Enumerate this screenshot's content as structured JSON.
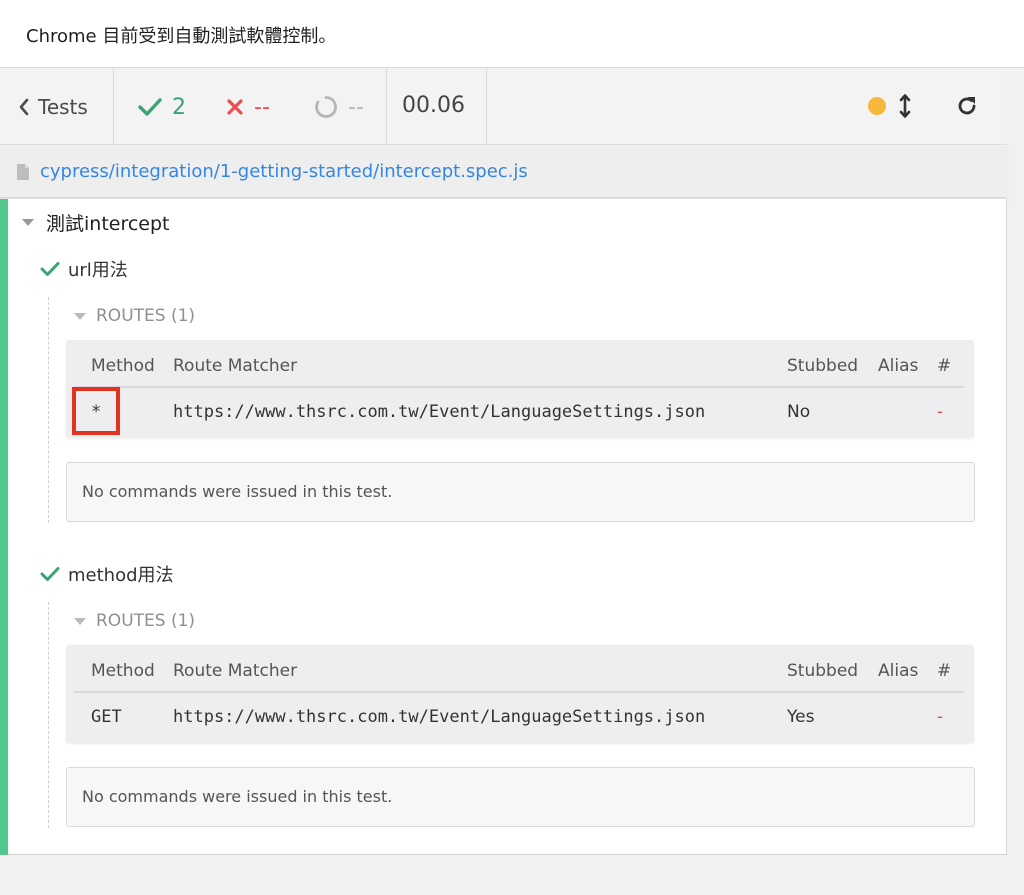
{
  "browser": {
    "automation_notice": "Chrome 目前受到自動測試軟體控制。"
  },
  "header": {
    "tests_label": "Tests",
    "passed_count": "2",
    "failed_count": "--",
    "pending_count": "--",
    "duration": "00.06",
    "icons": [
      "chevron-left-icon",
      "check-icon",
      "x-icon",
      "circle-notch-icon",
      "status-dot-icon",
      "arrows-v-icon",
      "redo-icon"
    ],
    "colors": {
      "passed": "#3aa573",
      "failed": "#e94f4f",
      "pending": "#b6b6b6",
      "running_dot": "#f5b73c"
    }
  },
  "spec": {
    "path": "cypress/integration/1-getting-started/intercept.spec.js",
    "icon": "file-icon"
  },
  "suite": {
    "title": "測試intercept",
    "tests": [
      {
        "title": "url用法",
        "routes_label": "ROUTES (1)",
        "columns": [
          "Method",
          "Route Matcher",
          "Stubbed",
          "Alias",
          "#"
        ],
        "routes": [
          {
            "method": "*",
            "matcher": "https://www.thsrc.com.tw/Event/LanguageSettings.json",
            "stubbed": "No",
            "alias": "",
            "count": "-"
          }
        ],
        "commands_text": "No commands were issued in this test."
      },
      {
        "title": "method用法",
        "routes_label": "ROUTES (1)",
        "columns": [
          "Method",
          "Route Matcher",
          "Stubbed",
          "Alias",
          "#"
        ],
        "routes": [
          {
            "method": "GET",
            "matcher": "https://www.thsrc.com.tw/Event/LanguageSettings.json",
            "stubbed": "Yes",
            "alias": "",
            "count": "-"
          }
        ],
        "commands_text": "No commands were issued in this test."
      }
    ]
  }
}
